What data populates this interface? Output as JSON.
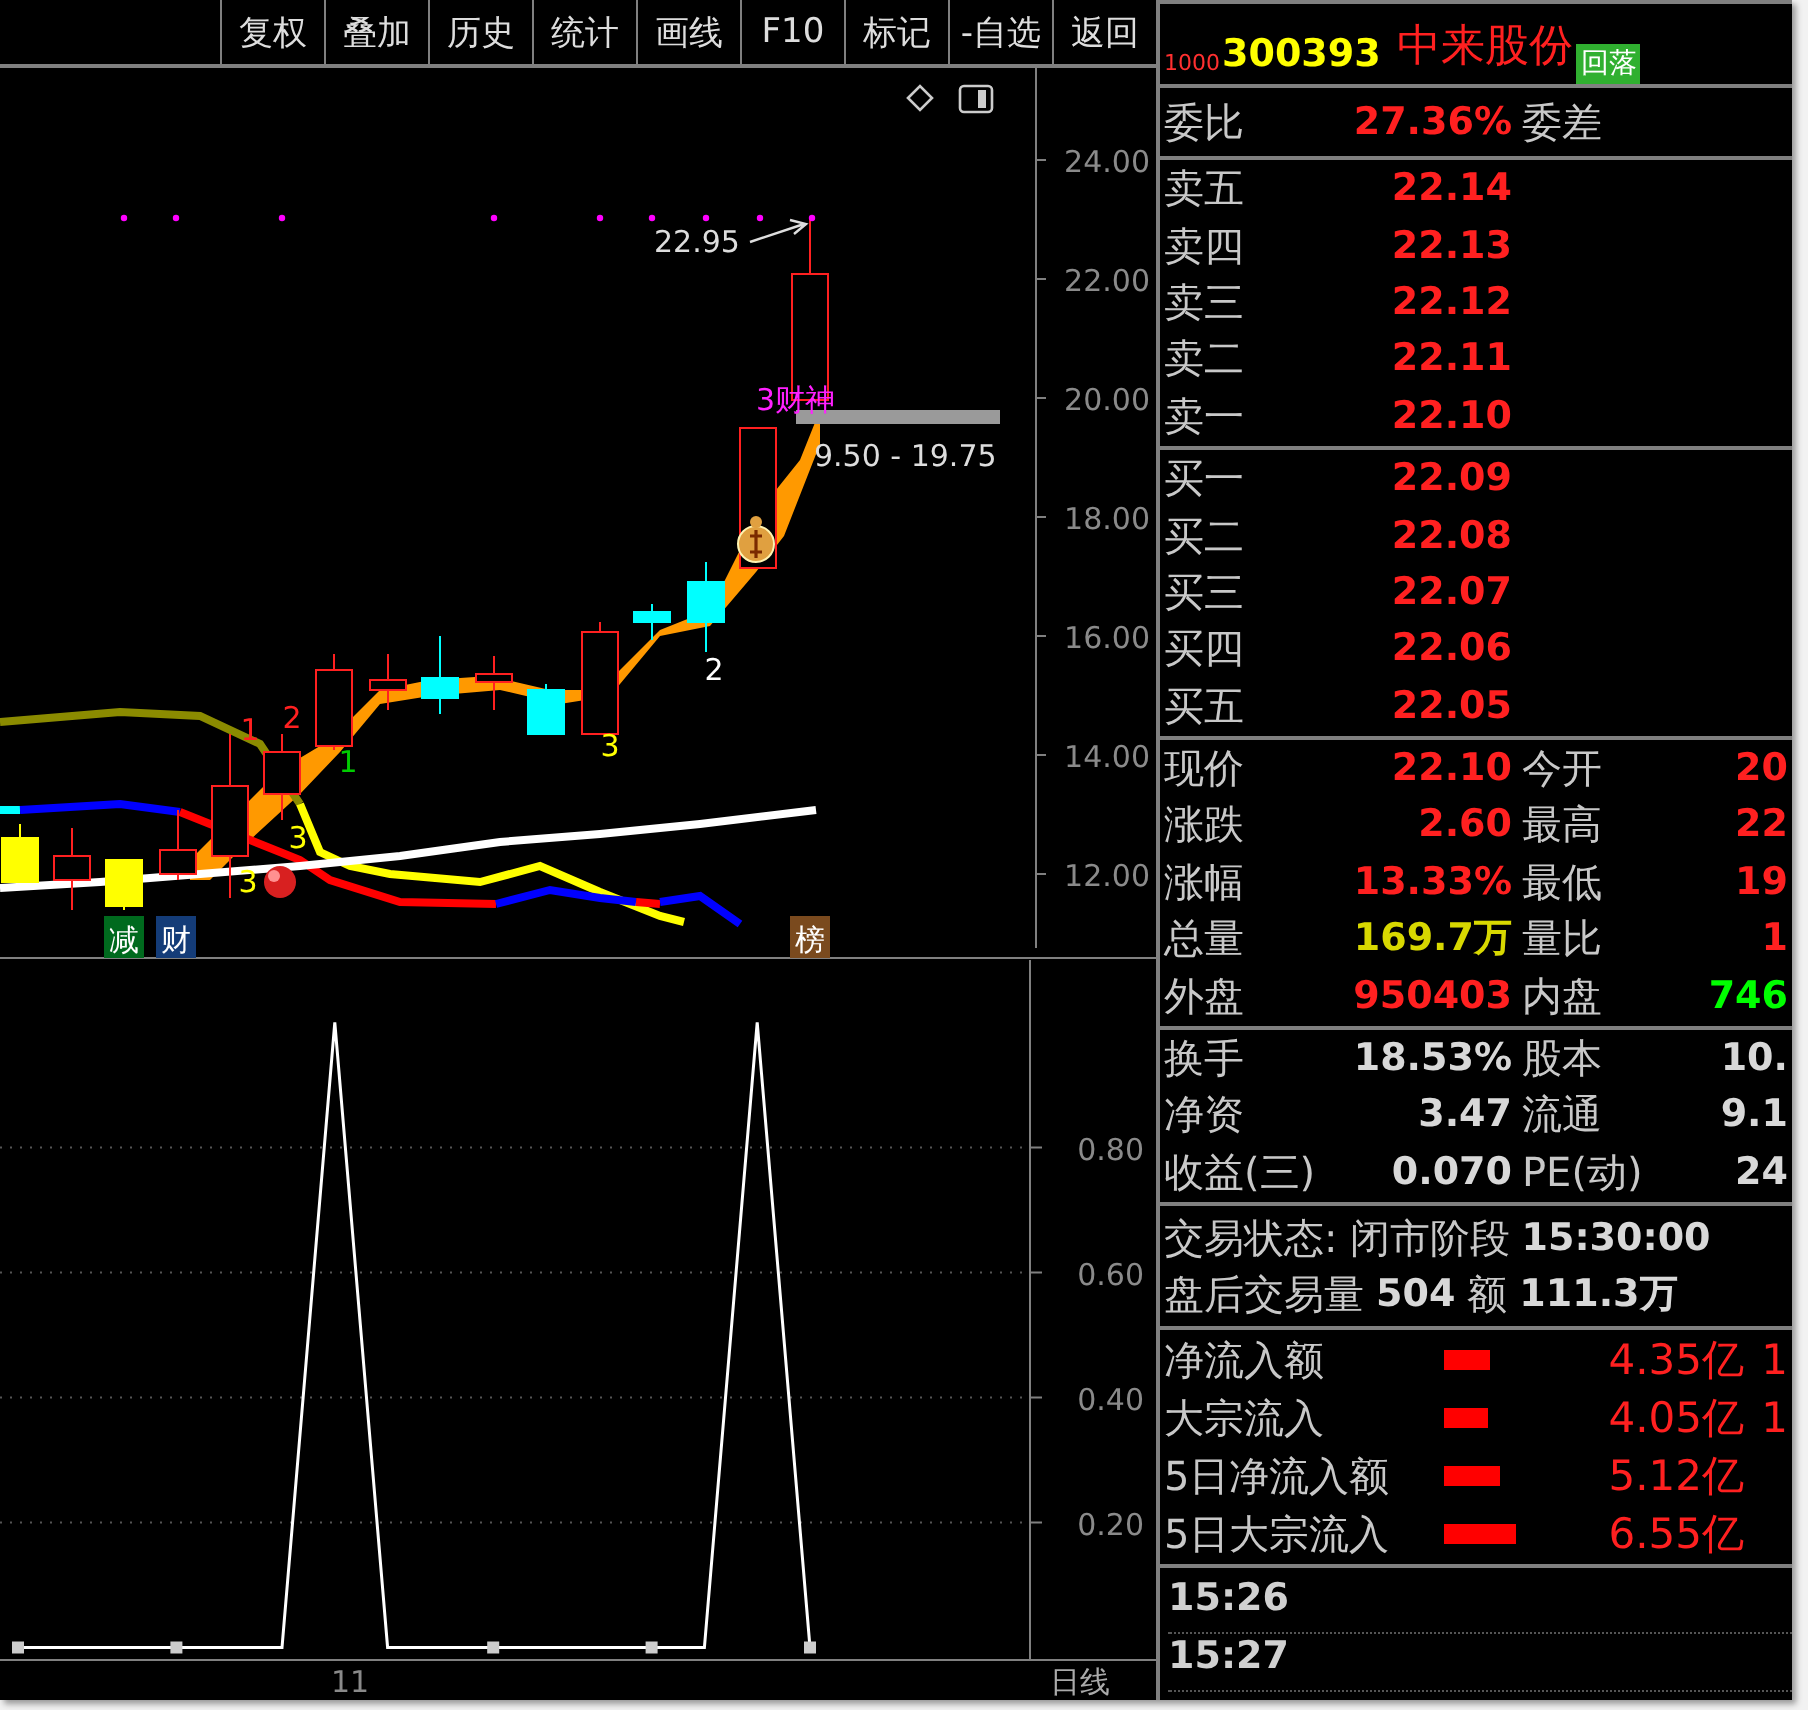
{
  "toolbar": {
    "buttons": [
      "复权",
      "叠加",
      "历史",
      "统计",
      "画线",
      "F10",
      "标记",
      "-自选",
      "返回"
    ]
  },
  "price_chart": {
    "y_axis": [
      "24.00",
      "22.00",
      "20.00",
      "18.00",
      "16.00",
      "14.00",
      "12.00"
    ],
    "peak_label": "22.95",
    "signal_label": "3财神",
    "range_label": "9.50 - 19.75",
    "candle_marks": [
      {
        "text": "3",
        "color": "#ffff00"
      },
      {
        "text": "1",
        "color": "#ff2020"
      },
      {
        "text": "2",
        "color": "#ff2020"
      },
      {
        "text": "3",
        "color": "#ffff00"
      },
      {
        "text": "1",
        "color": "#00cc00"
      },
      {
        "text": "3",
        "color": "#ffff00"
      },
      {
        "text": "2",
        "color": "#ffffff"
      }
    ],
    "tags": [
      {
        "text": "减",
        "color": "#006a1e"
      },
      {
        "text": "财",
        "color": "#143c78"
      },
      {
        "text": "榜",
        "color": "#7a4a1e"
      }
    ]
  },
  "indicator_chart": {
    "chart_data": {
      "type": "line",
      "series": [
        {
          "color": "#ffffff",
          "values": [
            0,
            0,
            0,
            0,
            0,
            0,
            1,
            0,
            0,
            0,
            0,
            0,
            0,
            0,
            1,
            0
          ]
        }
      ],
      "ylim": [
        -0.02,
        1.1
      ],
      "yticks": [
        {
          "value": 0.8,
          "label": "0.80"
        },
        {
          "value": 0.6,
          "label": "0.60"
        },
        {
          "value": 0.4,
          "label": "0.40"
        },
        {
          "value": 0.2,
          "label": "0.20"
        }
      ],
      "grid": true
    },
    "x_label": "11",
    "period": "日线"
  },
  "quote": {
    "market_code": "1000",
    "code": "300393",
    "name": "中来股份",
    "badge": "回落",
    "order_ratio": {
      "label": "委比",
      "value": "27.36%",
      "label2": "委差"
    },
    "asks": [
      {
        "label": "卖五",
        "price": "22.14"
      },
      {
        "label": "卖四",
        "price": "22.13"
      },
      {
        "label": "卖三",
        "price": "22.12"
      },
      {
        "label": "卖二",
        "price": "22.11"
      },
      {
        "label": "卖一",
        "price": "22.10"
      }
    ],
    "bids": [
      {
        "label": "买一",
        "price": "22.09"
      },
      {
        "label": "买二",
        "price": "22.08"
      },
      {
        "label": "买三",
        "price": "22.07"
      },
      {
        "label": "买四",
        "price": "22.06"
      },
      {
        "label": "买五",
        "price": "22.05"
      }
    ],
    "stats": [
      {
        "label": "现价",
        "value": {
          "text": "22.10",
          "color": "#ff2020"
        },
        "label2": "今开",
        "value2": {
          "text": "20",
          "color": "#ff2020"
        }
      },
      {
        "label": "涨跌",
        "value": {
          "text": "2.60",
          "color": "#ff2020"
        },
        "label2": "最高",
        "value2": {
          "text": "22",
          "color": "#ff2020"
        }
      },
      {
        "label": "涨幅",
        "value": {
          "text": "13.33%",
          "color": "#ff2020"
        },
        "label2": "最低",
        "value2": {
          "text": "19",
          "color": "#ff2020"
        }
      },
      {
        "label": "总量",
        "value": {
          "text": "169.7万",
          "color": "#d8d800"
        },
        "label2": "量比",
        "value2": {
          "text": "1",
          "color": "#ff2020"
        }
      },
      {
        "label": "外盘",
        "value": {
          "text": "950403",
          "color": "#ff2020"
        },
        "label2": "内盘",
        "value2": {
          "text": "746",
          "color": "#00ff00"
        }
      }
    ],
    "fundamentals": [
      {
        "label": "换手",
        "value": "18.53%",
        "label2": "股本",
        "value2": "10."
      },
      {
        "label": "净资",
        "value": "3.47",
        "label2": "流通",
        "value2": "9.1"
      },
      {
        "label": "收益(三)",
        "value": "0.070",
        "label2": "PE(动)",
        "value2": "24"
      }
    ],
    "session": {
      "status_label": "交易状态:",
      "status": "闭市阶段",
      "time": "15:30:00",
      "after_label": "盘后交易量",
      "after_volume": "504",
      "amount_label": "额",
      "amount": "111.3万"
    },
    "flows": [
      {
        "label": "净流入额",
        "value": "4.35亿",
        "extra": "1"
      },
      {
        "label": "大宗流入",
        "value": "4.05亿",
        "extra": "1"
      },
      {
        "label": "5日净流入额",
        "value": "5.12亿"
      },
      {
        "label": "5日大宗流入",
        "value": "6.55亿"
      }
    ],
    "ticks": [
      "15:26",
      "15:27"
    ]
  }
}
